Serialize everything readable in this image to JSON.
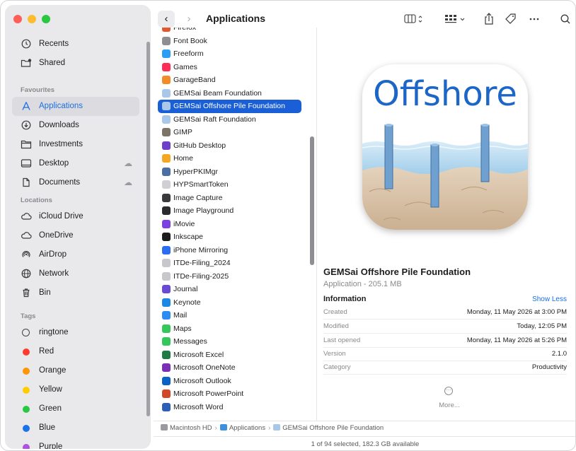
{
  "toolbar": {
    "back": "‹",
    "forward": "›",
    "title": "Applications",
    "view_icon": "column-view-icon",
    "group_icon": "group-icon",
    "share_icon": "share-icon",
    "tag_icon": "tag-icon",
    "more_icon": "ellipsis-icon",
    "search_icon": "search-icon"
  },
  "sidebar": {
    "top_items": [
      {
        "label": "Recents",
        "icon": "clock-icon"
      },
      {
        "label": "Shared",
        "icon": "shared-folder-icon"
      }
    ],
    "favourites_title": "Favourites",
    "favourites": [
      {
        "label": "Applications",
        "icon": "applications-icon",
        "active": true
      },
      {
        "label": "Downloads",
        "icon": "downloads-icon"
      },
      {
        "label": "Investments",
        "icon": "folder-icon"
      },
      {
        "label": "Desktop",
        "icon": "desktop-icon",
        "cloud": true
      },
      {
        "label": "Documents",
        "icon": "document-icon",
        "cloud": true
      }
    ],
    "locations_title": "Locations",
    "locations": [
      {
        "label": "iCloud Drive",
        "icon": "cloud-icon"
      },
      {
        "label": "OneDrive",
        "icon": "cloud-icon"
      },
      {
        "label": "AirDrop",
        "icon": "airdrop-icon"
      },
      {
        "label": "Network",
        "icon": "globe-icon"
      },
      {
        "label": "Bin",
        "icon": "trash-icon"
      }
    ],
    "tags_title": "Tags",
    "tags": [
      {
        "label": "ringtone",
        "color": ""
      },
      {
        "label": "Red",
        "color": "#ff3b30"
      },
      {
        "label": "Orange",
        "color": "#ff9500"
      },
      {
        "label": "Yellow",
        "color": "#ffcc00"
      },
      {
        "label": "Green",
        "color": "#28c840"
      },
      {
        "label": "Blue",
        "color": "#1a73e8"
      },
      {
        "label": "Purple",
        "color": "#af52de"
      }
    ]
  },
  "files": [
    {
      "name": "Firefox",
      "color": "#e4572e"
    },
    {
      "name": "Font Book",
      "color": "#8e8e93"
    },
    {
      "name": "Freeform",
      "color": "#2a9df4"
    },
    {
      "name": "Games",
      "color": "#ff2d55"
    },
    {
      "name": "GarageBand",
      "color": "#f28c28"
    },
    {
      "name": "GEMSai Beam Foundation",
      "color": "#a9c7e8"
    },
    {
      "name": "GEMSai Offshore Pile Foundation",
      "color": "#a9c7e8",
      "selected": true
    },
    {
      "name": "GEMSai Raft Foundation",
      "color": "#a9c7e8"
    },
    {
      "name": "GIMP",
      "color": "#7d7468"
    },
    {
      "name": "GitHub Desktop",
      "color": "#6e40c9"
    },
    {
      "name": "Home",
      "color": "#f5a623"
    },
    {
      "name": "HyperPKIMgr",
      "color": "#4a6fa5"
    },
    {
      "name": "HYPSmartToken",
      "color": "#d0d0d4"
    },
    {
      "name": "Image Capture",
      "color": "#3a3a3c"
    },
    {
      "name": "Image Playground",
      "color": "#2b2b2e"
    },
    {
      "name": "iMovie",
      "color": "#7b3fe4"
    },
    {
      "name": "Inkscape",
      "color": "#1d1d1f"
    },
    {
      "name": "iPhone Mirroring",
      "color": "#2a6df4"
    },
    {
      "name": "ITDe-Filing_2024",
      "color": "#c8c8cc"
    },
    {
      "name": "ITDe-Filing-2025",
      "color": "#c8c8cc"
    },
    {
      "name": "Journal",
      "color": "#6a4bd8"
    },
    {
      "name": "Keynote",
      "color": "#1e88e5"
    },
    {
      "name": "Mail",
      "color": "#2a8cf4"
    },
    {
      "name": "Maps",
      "color": "#34c759"
    },
    {
      "name": "Messages",
      "color": "#34c759"
    },
    {
      "name": "Microsoft Excel",
      "color": "#1f7a45"
    },
    {
      "name": "Microsoft OneNote",
      "color": "#7b2fb5"
    },
    {
      "name": "Microsoft Outlook",
      "color": "#0a64c8"
    },
    {
      "name": "Microsoft PowerPoint",
      "color": "#d24726"
    },
    {
      "name": "Microsoft Word",
      "color": "#2b5fb8"
    }
  ],
  "preview": {
    "icon_text": "Offshore",
    "name": "GEMSai Offshore Pile Foundation",
    "subtitle": "Application - 205.1 MB",
    "info_title": "Information",
    "show_less": "Show Less",
    "info": [
      {
        "key": "Created",
        "value": "Monday, 11 May 2026 at 3:00 PM"
      },
      {
        "key": "Modified",
        "value": "Today, 12:05 PM"
      },
      {
        "key": "Last opened",
        "value": "Monday, 11 May 2026 at 5:26 PM"
      },
      {
        "key": "Version",
        "value": "2.1.0"
      },
      {
        "key": "Category",
        "value": "Productivity"
      }
    ],
    "more": "More..."
  },
  "path": [
    "Macintosh HD",
    "Applications",
    "GEMSai Offshore Pile Foundation"
  ],
  "path_sep": "›",
  "status": "1 of 94 selected, 182.3 GB available"
}
